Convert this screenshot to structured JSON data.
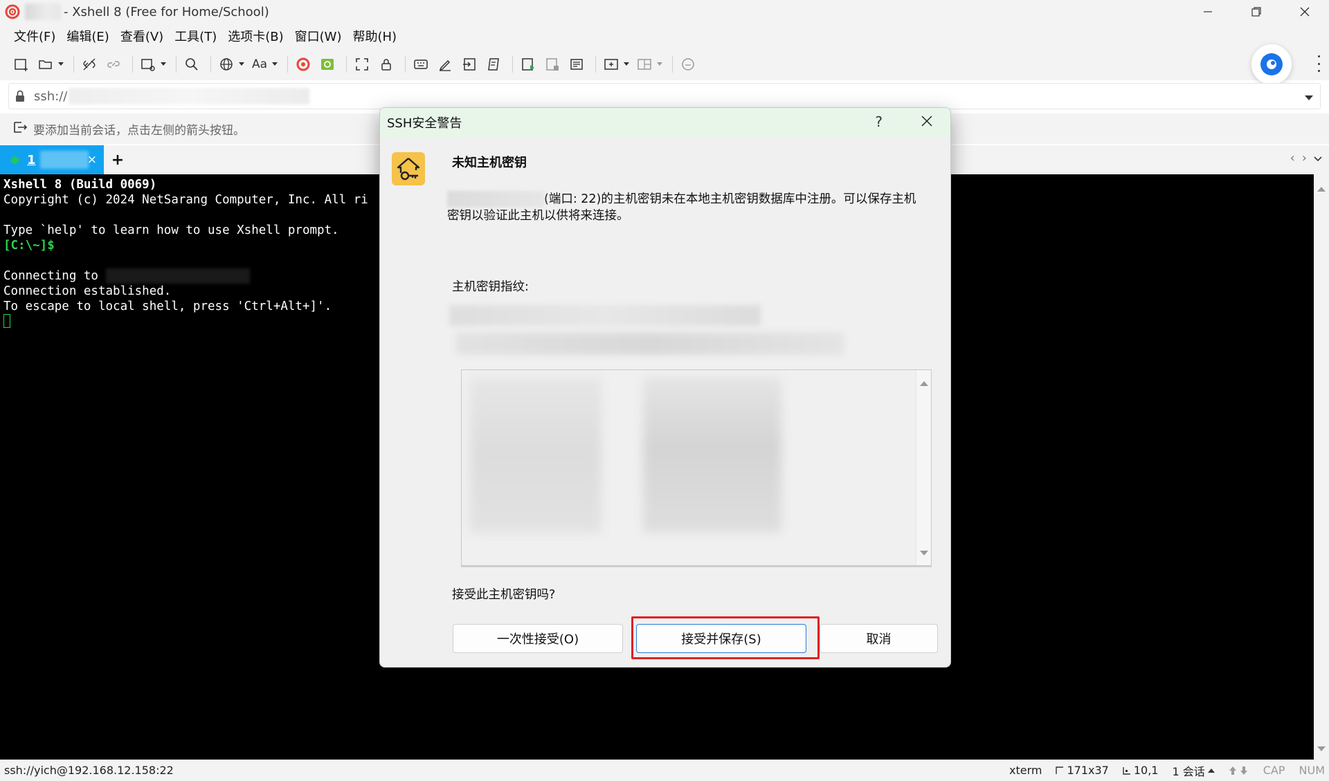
{
  "window": {
    "title": "- Xshell 8 (Free for Home/School)"
  },
  "menu": {
    "items": [
      "文件(F)",
      "编辑(E)",
      "查看(V)",
      "工具(T)",
      "选项卡(B)",
      "窗口(W)",
      "帮助(H)"
    ]
  },
  "toolbar": {
    "font_label": "Aa"
  },
  "address": {
    "prefix": "ssh://"
  },
  "session_hint": {
    "text": "要添加当前会话，点击左侧的箭头按钮。"
  },
  "tabs": {
    "active_label": "1",
    "add_label": "+",
    "close_label": "×",
    "nav_prev": "‹",
    "nav_next": "›"
  },
  "terminal": {
    "line1": "Xshell 8 (Build 0069)",
    "line2": "Copyright (c) 2024 NetSarang Computer, Inc. All ri",
    "line4": "Type `help' to learn how to use Xshell prompt.",
    "line5_prompt": "[C:\\~]$",
    "line7": "Connecting to ",
    "line8": "Connection established.",
    "line9": "To escape to local shell, press 'Ctrl+Alt+]'."
  },
  "status": {
    "connection": "ssh://yich@192.168.12.158:22",
    "terminal_type": "xterm",
    "size": "171x37",
    "cursor_pos": "10,1",
    "sessions": "1 会话",
    "cap": "CAP",
    "num": "NUM"
  },
  "dialog": {
    "title": "SSH安全警告",
    "help_label": "?",
    "heading": "未知主机密钥",
    "message": "(端口: 22)的主机密钥未在本地主机密钥数据库中注册。可以保存主机密钥以验证此主机以供将来连接。",
    "fingerprint_label": "主机密钥指纹:",
    "question": "接受此主机密钥吗?",
    "buttons": {
      "accept_once": "一次性接受(O)",
      "accept_save": "接受并保存(S)",
      "cancel": "取消"
    }
  },
  "colors": {
    "tab_active": "#12a3f0",
    "prompt_green": "#2bd34f",
    "dialog_title_bg": "#e8f6ea",
    "highlight_red": "#e02020",
    "primary_border": "#2b7bd8"
  }
}
